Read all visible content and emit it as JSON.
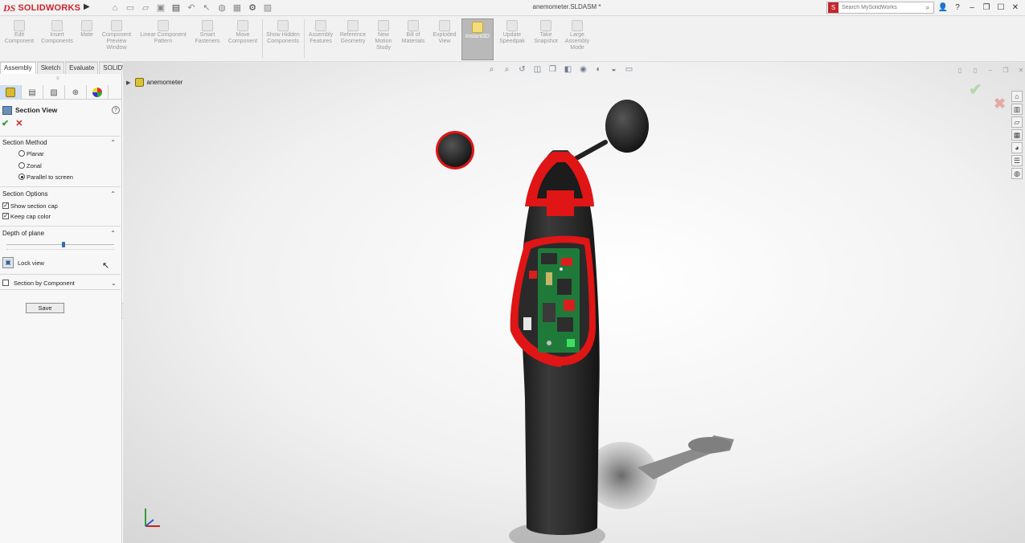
{
  "app": {
    "logo_ds": "DS",
    "logo_name": "SOLIDWORKS",
    "document_title": "anemometer.SLDASM *"
  },
  "search": {
    "placeholder": "Search MySolidWorks"
  },
  "quick_access_icons": [
    "home-icon",
    "new-icon",
    "open-icon",
    "save-icon",
    "print-icon",
    "undo-icon",
    "select-icon",
    "rebuild-icon",
    "file-properties-icon",
    "options-icon",
    "customize-icon"
  ],
  "title_icons": [
    "user-icon",
    "help-icon",
    "minimize-icon",
    "restore-icon",
    "maximize-icon"
  ],
  "command_manager": {
    "commands": [
      {
        "label": "Edit Component",
        "icon": "edit-component-icon"
      },
      {
        "label": "Insert Components",
        "icon": "insert-components-icon"
      },
      {
        "label": "Mate",
        "icon": "mate-icon"
      },
      {
        "label": "Component Preview Window",
        "icon": "component-preview-icon"
      },
      {
        "label": "Linear Component Pattern",
        "icon": "linear-pattern-icon"
      },
      {
        "label": "Smart Fasteners",
        "icon": "smart-fasteners-icon"
      },
      {
        "label": "Move Component",
        "icon": "move-component-icon"
      },
      {
        "label": "Show Hidden Components",
        "icon": "show-hidden-icon"
      },
      {
        "label": "Assembly Features",
        "icon": "assembly-features-icon"
      },
      {
        "label": "Reference Geometry",
        "icon": "reference-geometry-icon"
      },
      {
        "label": "New Motion Study",
        "icon": "motion-study-icon"
      },
      {
        "label": "Bill of Materials",
        "icon": "bom-icon"
      },
      {
        "label": "Exploded View",
        "icon": "exploded-view-icon"
      },
      {
        "label": "Instant3D",
        "icon": "instant3d-icon",
        "active": true
      },
      {
        "label": "Update Speedpak",
        "icon": "speedpak-icon"
      },
      {
        "label": "Take Snapshot",
        "icon": "snapshot-icon"
      },
      {
        "label": "Large Assembly Mode",
        "icon": "large-assembly-icon"
      }
    ]
  },
  "tabs": [
    "Assembly",
    "Sketch",
    "Evaluate",
    "SOLIDWORKS Add-Ins"
  ],
  "property_manager": {
    "title": "Section View",
    "section_method": {
      "title": "Section Method",
      "options": [
        "Planar",
        "Zonal",
        "Parallel to screen"
      ],
      "selected": "Parallel to screen"
    },
    "section_options": {
      "title": "Section Options",
      "show_section_cap": "Show section cap",
      "keep_cap_color": "Keep cap color"
    },
    "depth_of_plane": {
      "title": "Depth of plane",
      "value_fraction": 0.53
    },
    "lock_view": "Lock view",
    "section_by_component": "Section by Component",
    "save": "Save"
  },
  "feature_tree": {
    "root": "anemometer"
  },
  "colors": {
    "accent_red": "#d0232a",
    "cap_red": "#e01515",
    "selected_tab": "#cfe0f3"
  }
}
